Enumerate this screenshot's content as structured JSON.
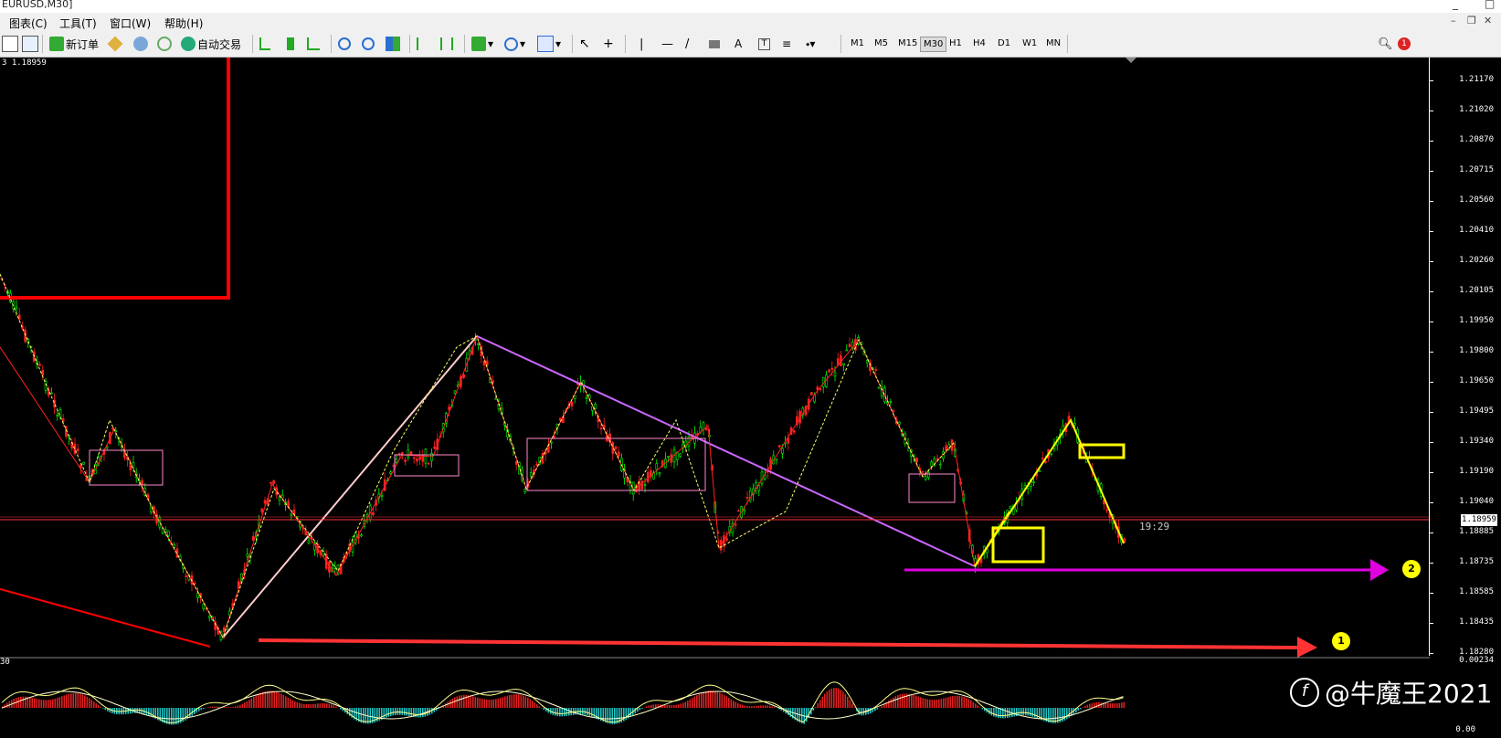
{
  "window": {
    "title": "EURUSD,M30]"
  },
  "menu": {
    "items": [
      "图表(C)",
      "工具(T)",
      "窗口(W)",
      "帮助(H)"
    ]
  },
  "toolbar": {
    "new_order": "新订单",
    "auto_trade": "自动交易",
    "timeframes": [
      "M1",
      "M5",
      "M15",
      "M30",
      "H1",
      "H4",
      "D1",
      "W1",
      "MN"
    ],
    "active_timeframe": "M30",
    "alerts_count": "1"
  },
  "chart": {
    "symbol_info": "3 1.18959",
    "current_price": "1.18959",
    "timer": "19:29",
    "price_ticks": [
      "1.21170",
      "1.21020",
      "1.20870",
      "1.20715",
      "1.20560",
      "1.20410",
      "1.20260",
      "1.20105",
      "1.19950",
      "1.19800",
      "1.19650",
      "1.19495",
      "1.19340",
      "1.19190",
      "1.19040",
      "1.18885",
      "1.18735",
      "1.18585",
      "1.18435",
      "1.18280"
    ],
    "markers": [
      "2",
      "1"
    ],
    "colors": {
      "bull": "#00ff00",
      "bear": "#ff0000",
      "red_line": "#ff0000",
      "purple_line": "#cc66ff",
      "yellow": "#ffff00",
      "magenta": "#e000e0",
      "pink_box": "#ff88cc"
    }
  },
  "macd": {
    "top_value": "0.00234",
    "bottom_value": "0.00",
    "left_label": "30"
  },
  "watermark": {
    "text": "@牛魔王2021"
  }
}
